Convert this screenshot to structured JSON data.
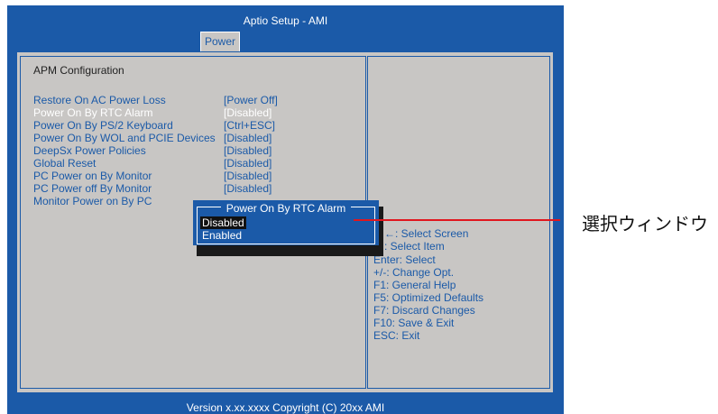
{
  "window": {
    "title": "Aptio Setup - AMI",
    "tab": "Power"
  },
  "section_title": "APM Configuration",
  "settings": [
    {
      "label": "Restore On AC Power Loss",
      "value": "[Power Off]"
    },
    {
      "label": "Power On By RTC Alarm",
      "value": "[Disabled]"
    },
    {
      "label": "Power On By PS/2 Keyboard",
      "value": "[Ctrl+ESC]"
    },
    {
      "label": "Power On By WOL and PCIE Devices",
      "value": "[Disabled]"
    },
    {
      "label": "DeepSx Power Policies",
      "value": "[Disabled]"
    },
    {
      "label": "Global Reset",
      "value": "[Disabled]"
    },
    {
      "label": "PC Power on By Monitor",
      "value": "[Disabled]"
    },
    {
      "label": "PC Power off By Monitor",
      "value": "[Disabled]"
    },
    {
      "label": "Monitor Power on By PC",
      "value": ""
    }
  ],
  "popup": {
    "title": "Power On By RTC Alarm",
    "options": [
      "Disabled",
      "Enabled"
    ],
    "selected": "Disabled"
  },
  "help": [
    "→←: Select Screen",
    "↑↓: Select Item",
    "Enter: Select",
    "+/-: Change Opt.",
    "F1: General Help",
    "F5: Optimized Defaults",
    "F7: Discard Changes",
    "F10: Save & Exit",
    "ESC: Exit"
  ],
  "footer": "Version x.xx.xxxx Copyright (C) 20xx AMI",
  "annotation": "選択ウィンドウ",
  "colors": {
    "bios_blue": "#1b5aa8",
    "panel_gray": "#c8c6c4",
    "pointer_red": "#e0161e"
  }
}
